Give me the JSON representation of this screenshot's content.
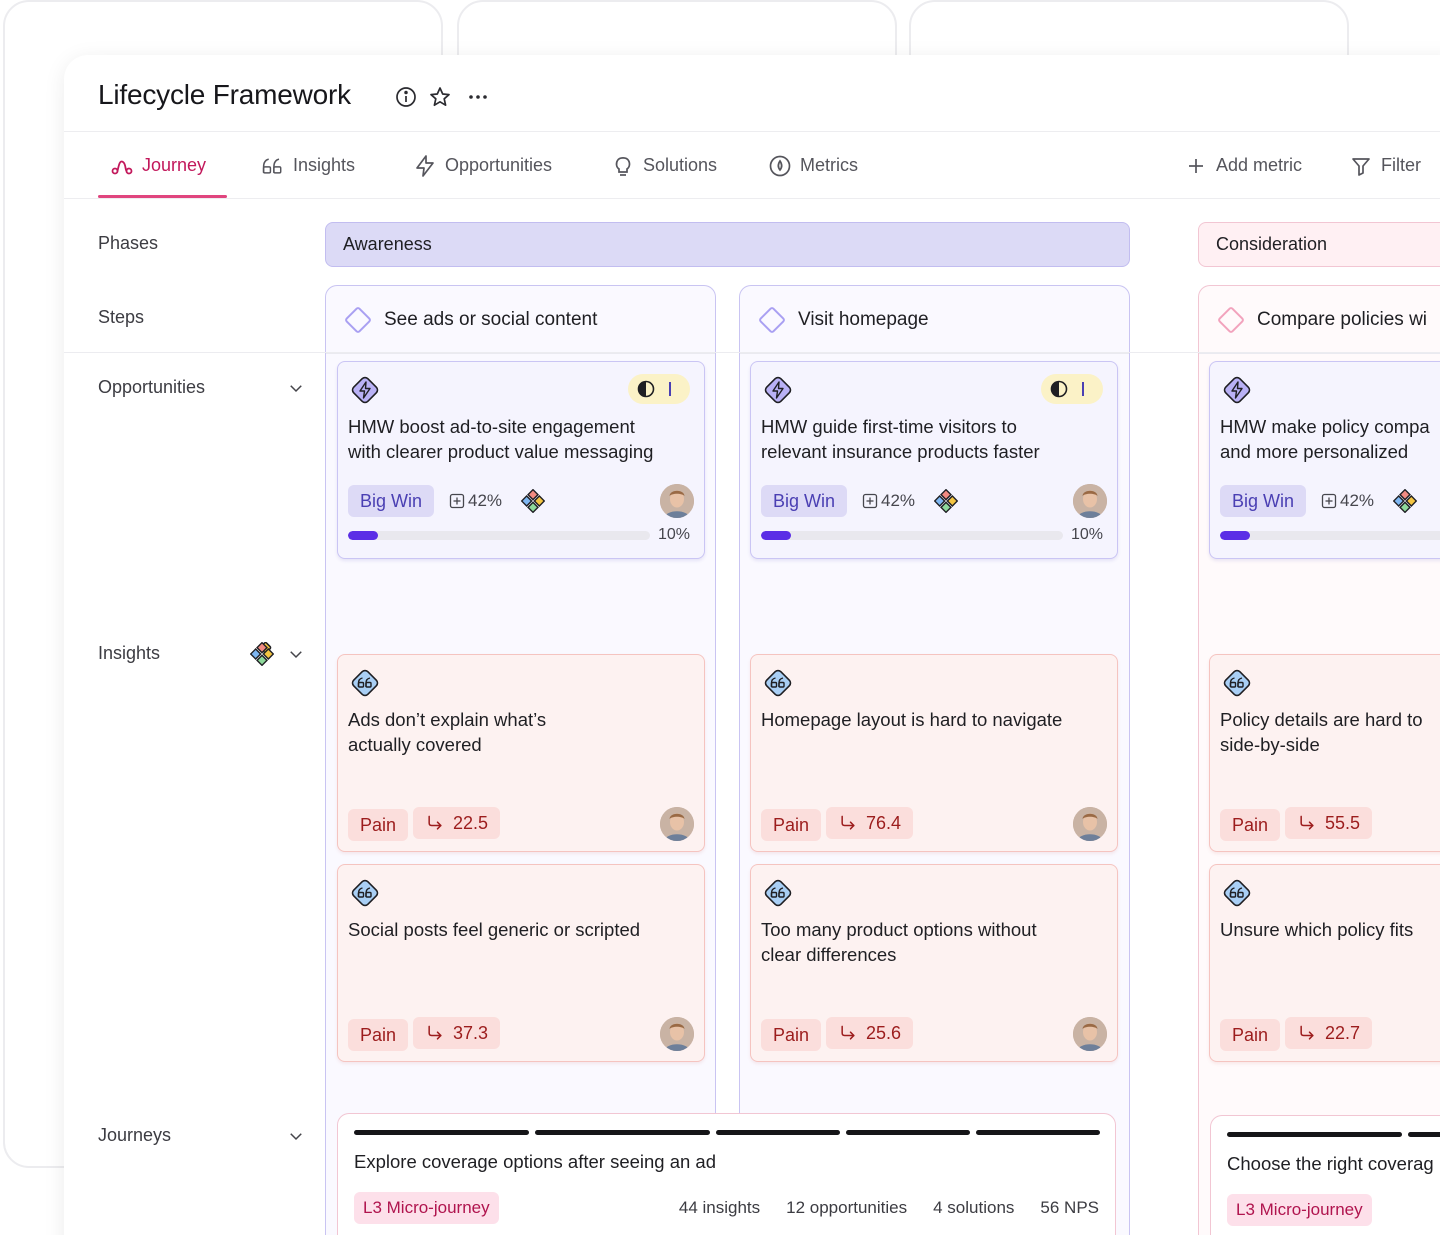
{
  "page": {
    "title": "Lifecycle Framework"
  },
  "tabs": [
    {
      "label": "Journey",
      "icon": "journey-icon",
      "active": true
    },
    {
      "label": "Insights",
      "icon": "quote-icon",
      "active": false
    },
    {
      "label": "Opportunities",
      "icon": "lightning-icon",
      "active": false
    },
    {
      "label": "Solutions",
      "icon": "lightbulb-icon",
      "active": false
    },
    {
      "label": "Metrics",
      "icon": "gauge-icon",
      "active": false
    }
  ],
  "actions": {
    "add_metric": "Add metric",
    "filter": "Filter"
  },
  "rows": {
    "phases": "Phases",
    "steps": "Steps",
    "opportunities": "Opportunities",
    "insights": "Insights",
    "journeys": "Journeys"
  },
  "phases": [
    {
      "label": "Awareness",
      "color": "#dcdaf6"
    },
    {
      "label": "Consideration",
      "color": "#fff0f3"
    }
  ],
  "steps": [
    {
      "label": "See ads or social content"
    },
    {
      "label": "Visit homepage"
    },
    {
      "label": "Compare policies wi"
    }
  ],
  "opportunities": [
    {
      "title_line1": "HMW boost ad-to-site engagement",
      "title_line2": "with clearer product value messaging",
      "tag": "Big Win",
      "confidence": "42%",
      "progress_text": "10%",
      "progress": 0.1
    },
    {
      "title_line1": "HMW guide first-time visitors to",
      "title_line2": "relevant insurance products faster",
      "tag": "Big Win",
      "confidence": "42%",
      "progress_text": "10%",
      "progress": 0.1
    },
    {
      "title_line1": "HMW make policy compa",
      "title_line2": "and more personalized",
      "tag": "Big Win",
      "confidence": "42%",
      "progress": 0.1
    }
  ],
  "insights": [
    [
      {
        "line1": "Ads don’t explain what’s",
        "line2": "actually covered",
        "tag": "Pain",
        "score": "22.5"
      },
      {
        "line1": "Social posts feel generic or scripted",
        "line2": "",
        "tag": "Pain",
        "score": "37.3"
      }
    ],
    [
      {
        "line1": "Homepage layout is hard to navigate",
        "line2": "",
        "tag": "Pain",
        "score": "76.4"
      },
      {
        "line1": "Too many product options without",
        "line2": "clear differences",
        "tag": "Pain",
        "score": "25.6"
      }
    ],
    [
      {
        "line1": "Policy details are hard to",
        "line2": "side-by-side",
        "tag": "Pain",
        "score": "55.5"
      },
      {
        "line1": "Unsure which policy fits",
        "line2": "",
        "tag": "Pain",
        "score": "22.7"
      }
    ]
  ],
  "journeys": [
    {
      "title": "Explore coverage options after seeing an ad",
      "tag": "L3 Micro-journey",
      "stats": [
        "44 insights",
        "12 opportunities",
        "4 solutions",
        "56 NPS"
      ]
    },
    {
      "title": "Choose the right coverag",
      "tag": "L3 Micro-journey"
    }
  ],
  "colors": {
    "accent_pink": "#c2185b",
    "awareness": "#dcdaf6",
    "opportunity_bar": "#5b2ee6",
    "pain_chip": "#fbdedc"
  }
}
